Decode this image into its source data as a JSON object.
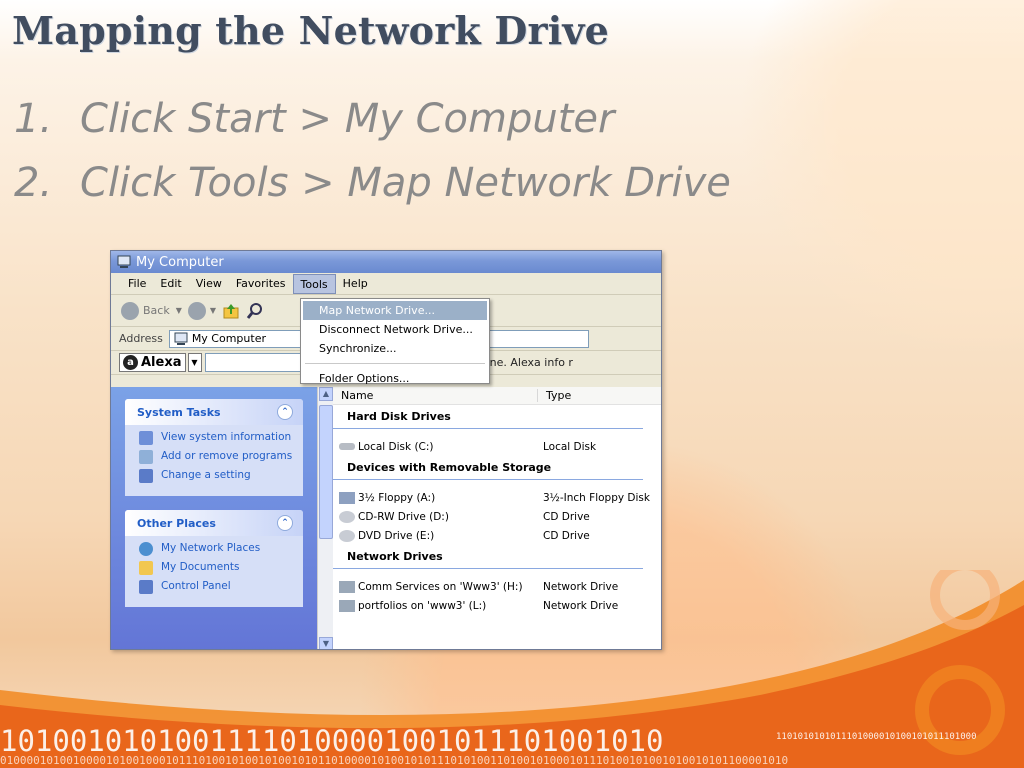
{
  "slide": {
    "title": "Mapping the Network Drive",
    "steps": [
      {
        "num": "1.",
        "text": "Click Start > My Computer"
      },
      {
        "num": "2.",
        "text": "Click Tools > Map Network Drive"
      }
    ]
  },
  "window": {
    "title": "My Computer",
    "menu": [
      "File",
      "Edit",
      "View",
      "Favorites",
      "Tools",
      "Help"
    ],
    "toolbar": {
      "back_label": "Back"
    },
    "address": {
      "label": "Address",
      "value": "My Computer"
    },
    "alexa": {
      "label": "Alexa",
      "info": "tranet site, or offline. Alexa info r"
    },
    "tools_menu": [
      "Map Network Drive...",
      "Disconnect Network Drive...",
      "Synchronize...",
      "Folder Options..."
    ],
    "system_tasks": {
      "title": "System Tasks",
      "items": [
        "View system information",
        "Add or remove programs",
        "Change a setting"
      ]
    },
    "other_places": {
      "title": "Other Places",
      "items": [
        "My Network Places",
        "My Documents",
        "Control Panel"
      ]
    },
    "columns": {
      "name": "Name",
      "type": "Type"
    },
    "groups": {
      "hard_disk": {
        "title": "Hard Disk Drives",
        "items": [
          {
            "name": "Local Disk (C:)",
            "type": "Local Disk"
          }
        ]
      },
      "removable": {
        "title": "Devices with Removable Storage",
        "items": [
          {
            "name": "3½ Floppy (A:)",
            "type": "3½-Inch Floppy Disk"
          },
          {
            "name": "CD-RW Drive (D:)",
            "type": "CD Drive"
          },
          {
            "name": "DVD Drive (E:)",
            "type": "CD Drive"
          }
        ]
      },
      "network": {
        "title": "Network Drives",
        "items": [
          {
            "name": "Comm Services on 'Www3' (H:)",
            "type": "Network Drive"
          },
          {
            "name": "portfolios on 'www3' (L:)",
            "type": "Network Drive"
          }
        ]
      }
    }
  },
  "footer": {
    "binary_large": "10100101010011110100001001011101001010",
    "binary_small": "1101010101011101000010100101011101000",
    "binary_bottom": "01000010100100001010010001011101001010010100101011010000101001010111010100110100101000101110100101001010010101100001010"
  }
}
